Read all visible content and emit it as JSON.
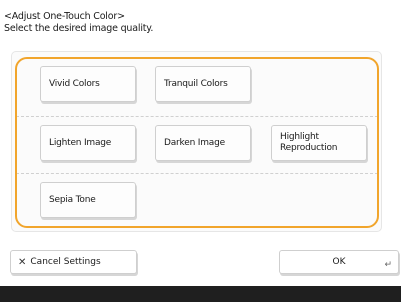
{
  "header": {
    "title": "<Adjust One-Touch Color>",
    "instruction": "Select the desired image quality."
  },
  "options": {
    "vivid_colors": "Vivid Colors",
    "tranquil_colors": "Tranquil Colors",
    "lighten_image": "Lighten Image",
    "darken_image": "Darken Image",
    "highlight_reproduction": "Highlight Reproduction",
    "sepia_tone": "Sepia Tone"
  },
  "footer": {
    "cancel_label": "Cancel Settings",
    "ok_label": "OK"
  },
  "icons": {
    "cancel": "close-icon",
    "ok": "enter-icon"
  },
  "colors": {
    "selection_frame": "#f1a52c",
    "bottom_bar": "#1f1f1f"
  }
}
